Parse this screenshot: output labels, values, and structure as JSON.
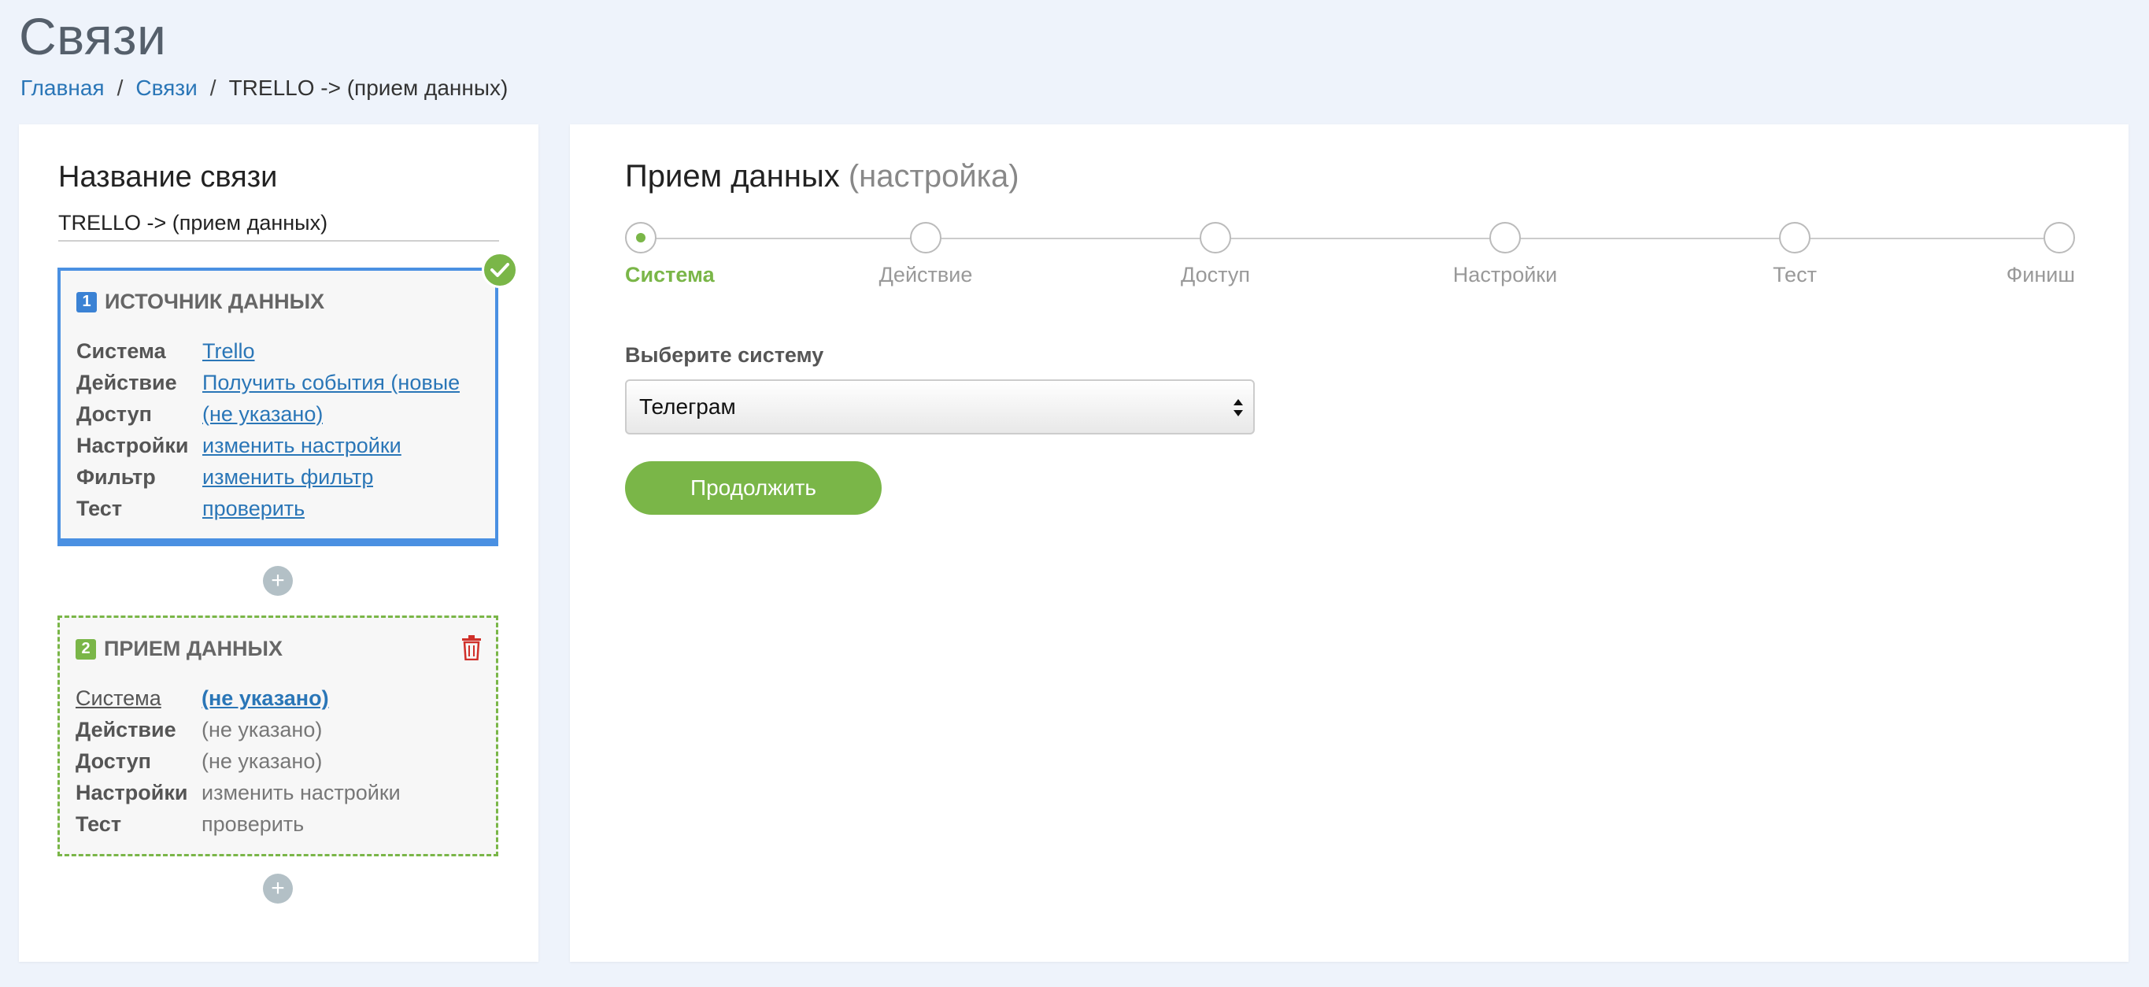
{
  "page": {
    "title": "Связи"
  },
  "breadcrumb": {
    "home": "Главная",
    "links": "Связи",
    "current": "TRELLO -> (прием данных)"
  },
  "left_panel": {
    "heading": "Название связи",
    "link_name": "TRELLO -> (прием данных)",
    "source_block": {
      "number": "1",
      "title": "ИСТОЧНИК ДАННЫХ",
      "status_icon": "check-circle-icon",
      "rows": [
        {
          "label": "Система",
          "value": "Trello"
        },
        {
          "label": "Действие",
          "value": "Получить события (новые"
        },
        {
          "label": "Доступ",
          "value": "(не указано)"
        },
        {
          "label": "Настройки",
          "value": "изменить настройки"
        },
        {
          "label": "Фильтр",
          "value": "изменить фильтр"
        },
        {
          "label": "Тест",
          "value": "проверить"
        }
      ]
    },
    "add_button_label": "+",
    "receiver_block": {
      "number": "2",
      "title": "ПРИЕМ ДАННЫХ",
      "delete_icon": "trash-icon",
      "rows": [
        {
          "label": "Система",
          "value": "(не указано)"
        },
        {
          "label": "Действие",
          "value": "(не указано)"
        },
        {
          "label": "Доступ",
          "value": "(не указано)"
        },
        {
          "label": "Настройки",
          "value": "изменить настройки"
        },
        {
          "label": "Тест",
          "value": "проверить"
        }
      ]
    }
  },
  "right_panel": {
    "heading": "Прием данных",
    "heading_sub": "(настройка)",
    "steps": [
      {
        "label": "Система",
        "active": true
      },
      {
        "label": "Действие",
        "active": false
      },
      {
        "label": "Доступ",
        "active": false
      },
      {
        "label": "Настройки",
        "active": false
      },
      {
        "label": "Тест",
        "active": false
      },
      {
        "label": "Финиш",
        "active": false
      }
    ],
    "select_label": "Выберите систему",
    "select_value": "Телеграм",
    "continue_label": "Продолжить"
  },
  "colors": {
    "accent_green": "#7ab648",
    "accent_blue": "#4a90e2",
    "link_blue": "#2a76b7",
    "delete_red": "#d0302a"
  }
}
